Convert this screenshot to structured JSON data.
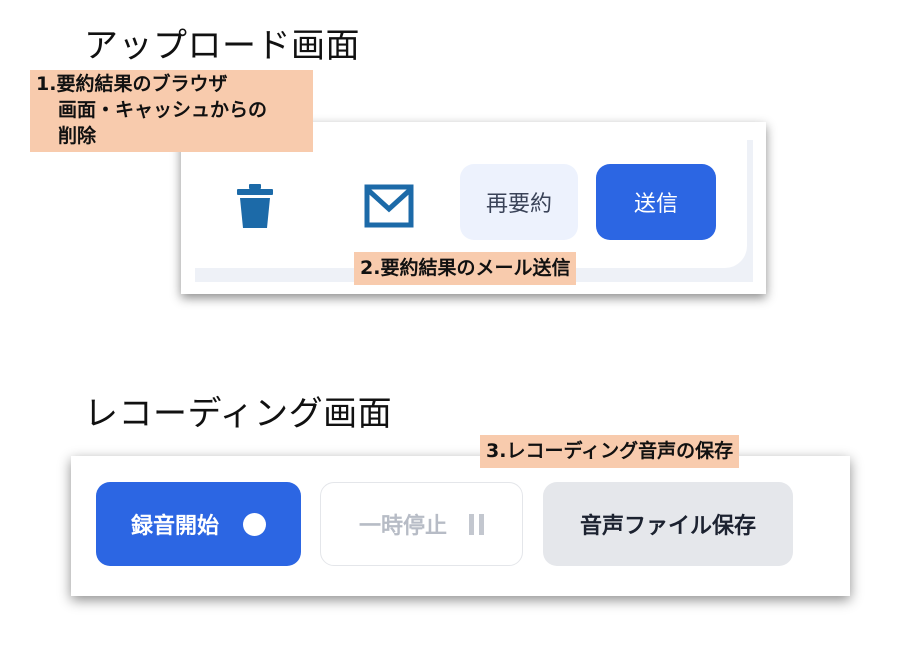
{
  "upload_screen": {
    "title": "アップロード画面",
    "callout_1": {
      "line1": "1.要約結果のブラウザ",
      "line2": "画面・キャッシュからの",
      "line3": "削除"
    },
    "callout_2": "2.要約結果のメール送信",
    "buttons": {
      "delete_icon": "trash-icon",
      "mail_icon": "mail-icon",
      "resummarize_label": "再要約",
      "send_label": "送信"
    }
  },
  "recording_screen": {
    "title": "レコーディング画面",
    "callout_3": "3.レコーディング音声の保存",
    "buttons": {
      "record_start_label": "録音開始",
      "pause_label": "一時停止",
      "save_audio_label": "音声ファイル保存"
    }
  },
  "colors": {
    "accent_blue": "#2c66e3",
    "icon_blue": "#1c6aa8",
    "callout_bg": "#f8cbad",
    "light_button_bg": "#edf2fd",
    "gray_button_bg": "#e5e7eb"
  }
}
